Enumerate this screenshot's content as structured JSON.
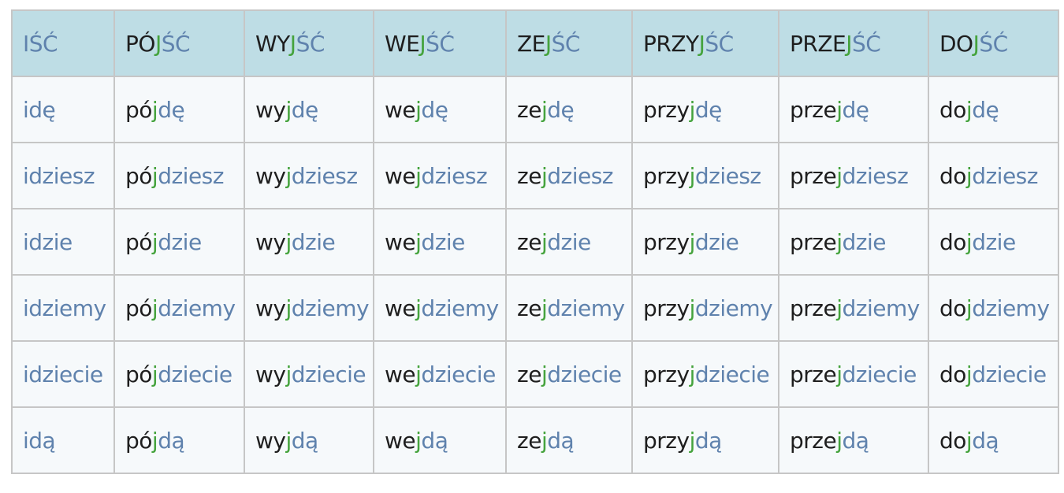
{
  "colors": {
    "header_background": "#bedde5",
    "cell_background": "#f6f9fb",
    "border": "#c6c6c6",
    "prefix_text": "#1e1e1e",
    "stem_text": "#5f82ad",
    "inserted_j": "#45a33d"
  },
  "columns": [
    {
      "header": [
        {
          "t": "IŚĆ",
          "c": "blue"
        }
      ],
      "forms": [
        [
          {
            "t": "i",
            "c": "blue"
          },
          {
            "t": "dę",
            "c": "blue"
          }
        ],
        [
          {
            "t": "i",
            "c": "blue"
          },
          {
            "t": "dziesz",
            "c": "blue"
          }
        ],
        [
          {
            "t": "i",
            "c": "blue"
          },
          {
            "t": "dzie",
            "c": "blue"
          }
        ],
        [
          {
            "t": "i",
            "c": "blue"
          },
          {
            "t": "dziemy",
            "c": "blue"
          }
        ],
        [
          {
            "t": "i",
            "c": "blue"
          },
          {
            "t": "dziecie",
            "c": "blue"
          }
        ],
        [
          {
            "t": "i",
            "c": "blue"
          },
          {
            "t": "dą",
            "c": "blue"
          }
        ]
      ]
    },
    {
      "header": [
        {
          "t": "PÓ",
          "c": "black"
        },
        {
          "t": "J",
          "c": "green"
        },
        {
          "t": "ŚĆ",
          "c": "blue"
        }
      ],
      "forms": [
        [
          {
            "t": "pó",
            "c": "black"
          },
          {
            "t": "j",
            "c": "green"
          },
          {
            "t": "dę",
            "c": "blue"
          }
        ],
        [
          {
            "t": "pó",
            "c": "black"
          },
          {
            "t": "j",
            "c": "green"
          },
          {
            "t": "dziesz",
            "c": "blue"
          }
        ],
        [
          {
            "t": "pó",
            "c": "black"
          },
          {
            "t": "j",
            "c": "green"
          },
          {
            "t": "dzie",
            "c": "blue"
          }
        ],
        [
          {
            "t": "pó",
            "c": "black"
          },
          {
            "t": "j",
            "c": "green"
          },
          {
            "t": "dziemy",
            "c": "blue"
          }
        ],
        [
          {
            "t": "pó",
            "c": "black"
          },
          {
            "t": "j",
            "c": "green"
          },
          {
            "t": "dziecie",
            "c": "blue"
          }
        ],
        [
          {
            "t": "pó",
            "c": "black"
          },
          {
            "t": "j",
            "c": "green"
          },
          {
            "t": "dą",
            "c": "blue"
          }
        ]
      ]
    },
    {
      "header": [
        {
          "t": "WY",
          "c": "black"
        },
        {
          "t": "J",
          "c": "green"
        },
        {
          "t": "ŚĆ",
          "c": "blue"
        }
      ],
      "forms": [
        [
          {
            "t": "wy",
            "c": "black"
          },
          {
            "t": "j",
            "c": "green"
          },
          {
            "t": "dę",
            "c": "blue"
          }
        ],
        [
          {
            "t": "wy",
            "c": "black"
          },
          {
            "t": "j",
            "c": "green"
          },
          {
            "t": "dziesz",
            "c": "blue"
          }
        ],
        [
          {
            "t": "wy",
            "c": "black"
          },
          {
            "t": "j",
            "c": "green"
          },
          {
            "t": "dzie",
            "c": "blue"
          }
        ],
        [
          {
            "t": "wy",
            "c": "black"
          },
          {
            "t": "j",
            "c": "green"
          },
          {
            "t": "dziemy",
            "c": "blue"
          }
        ],
        [
          {
            "t": "wy",
            "c": "black"
          },
          {
            "t": "j",
            "c": "green"
          },
          {
            "t": "dziecie",
            "c": "blue"
          }
        ],
        [
          {
            "t": "wy",
            "c": "black"
          },
          {
            "t": "j",
            "c": "green"
          },
          {
            "t": "dą",
            "c": "blue"
          }
        ]
      ]
    },
    {
      "header": [
        {
          "t": "WE",
          "c": "black"
        },
        {
          "t": "J",
          "c": "green"
        },
        {
          "t": "ŚĆ",
          "c": "blue"
        }
      ],
      "forms": [
        [
          {
            "t": "we",
            "c": "black"
          },
          {
            "t": "j",
            "c": "green"
          },
          {
            "t": "dę",
            "c": "blue"
          }
        ],
        [
          {
            "t": "we",
            "c": "black"
          },
          {
            "t": "j",
            "c": "green"
          },
          {
            "t": "dziesz",
            "c": "blue"
          }
        ],
        [
          {
            "t": "we",
            "c": "black"
          },
          {
            "t": "j",
            "c": "green"
          },
          {
            "t": "dzie",
            "c": "blue"
          }
        ],
        [
          {
            "t": "we",
            "c": "black"
          },
          {
            "t": "j",
            "c": "green"
          },
          {
            "t": "dziemy",
            "c": "blue"
          }
        ],
        [
          {
            "t": "we",
            "c": "black"
          },
          {
            "t": "j",
            "c": "green"
          },
          {
            "t": "dziecie",
            "c": "blue"
          }
        ],
        [
          {
            "t": "we",
            "c": "black"
          },
          {
            "t": "j",
            "c": "green"
          },
          {
            "t": "dą",
            "c": "blue"
          }
        ]
      ]
    },
    {
      "header": [
        {
          "t": "ZE",
          "c": "black"
        },
        {
          "t": "J",
          "c": "green"
        },
        {
          "t": "ŚĆ",
          "c": "blue"
        }
      ],
      "forms": [
        [
          {
            "t": "ze",
            "c": "black"
          },
          {
            "t": "j",
            "c": "green"
          },
          {
            "t": "dę",
            "c": "blue"
          }
        ],
        [
          {
            "t": "ze",
            "c": "black"
          },
          {
            "t": "j",
            "c": "green"
          },
          {
            "t": "dziesz",
            "c": "blue"
          }
        ],
        [
          {
            "t": "ze",
            "c": "black"
          },
          {
            "t": "j",
            "c": "green"
          },
          {
            "t": "dzie",
            "c": "blue"
          }
        ],
        [
          {
            "t": "ze",
            "c": "black"
          },
          {
            "t": "j",
            "c": "green"
          },
          {
            "t": "dziemy",
            "c": "blue"
          }
        ],
        [
          {
            "t": "ze",
            "c": "black"
          },
          {
            "t": "j",
            "c": "green"
          },
          {
            "t": "dziecie",
            "c": "blue"
          }
        ],
        [
          {
            "t": "ze",
            "c": "black"
          },
          {
            "t": "j",
            "c": "green"
          },
          {
            "t": "dą",
            "c": "blue"
          }
        ]
      ]
    },
    {
      "header": [
        {
          "t": "PRZY",
          "c": "black"
        },
        {
          "t": "J",
          "c": "green"
        },
        {
          "t": "ŚĆ",
          "c": "blue"
        }
      ],
      "forms": [
        [
          {
            "t": "przy",
            "c": "black"
          },
          {
            "t": "j",
            "c": "green"
          },
          {
            "t": "dę",
            "c": "blue"
          }
        ],
        [
          {
            "t": "przy",
            "c": "black"
          },
          {
            "t": "j",
            "c": "green"
          },
          {
            "t": "dziesz",
            "c": "blue"
          }
        ],
        [
          {
            "t": "przy",
            "c": "black"
          },
          {
            "t": "j",
            "c": "green"
          },
          {
            "t": "dzie",
            "c": "blue"
          }
        ],
        [
          {
            "t": "przy",
            "c": "black"
          },
          {
            "t": "j",
            "c": "green"
          },
          {
            "t": "dziemy",
            "c": "blue"
          }
        ],
        [
          {
            "t": "przy",
            "c": "black"
          },
          {
            "t": "j",
            "c": "green"
          },
          {
            "t": "dziecie",
            "c": "blue"
          }
        ],
        [
          {
            "t": "przy",
            "c": "black"
          },
          {
            "t": "j",
            "c": "green"
          },
          {
            "t": "dą",
            "c": "blue"
          }
        ]
      ]
    },
    {
      "header": [
        {
          "t": "PRZE",
          "c": "black"
        },
        {
          "t": "J",
          "c": "green"
        },
        {
          "t": "ŚĆ",
          "c": "blue"
        }
      ],
      "forms": [
        [
          {
            "t": "prze",
            "c": "black"
          },
          {
            "t": "j",
            "c": "green"
          },
          {
            "t": "dę",
            "c": "blue"
          }
        ],
        [
          {
            "t": "prze",
            "c": "black"
          },
          {
            "t": "j",
            "c": "green"
          },
          {
            "t": "dziesz",
            "c": "blue"
          }
        ],
        [
          {
            "t": "prze",
            "c": "black"
          },
          {
            "t": "j",
            "c": "green"
          },
          {
            "t": "dzie",
            "c": "blue"
          }
        ],
        [
          {
            "t": "prze",
            "c": "black"
          },
          {
            "t": "j",
            "c": "green"
          },
          {
            "t": "dziemy",
            "c": "blue"
          }
        ],
        [
          {
            "t": "prze",
            "c": "black"
          },
          {
            "t": "j",
            "c": "green"
          },
          {
            "t": "dziecie",
            "c": "blue"
          }
        ],
        [
          {
            "t": "prze",
            "c": "black"
          },
          {
            "t": "j",
            "c": "green"
          },
          {
            "t": "dą",
            "c": "blue"
          }
        ]
      ]
    },
    {
      "header": [
        {
          "t": "DO",
          "c": "black"
        },
        {
          "t": "J",
          "c": "green"
        },
        {
          "t": "ŚĆ",
          "c": "blue"
        }
      ],
      "forms": [
        [
          {
            "t": "do",
            "c": "black"
          },
          {
            "t": "j",
            "c": "green"
          },
          {
            "t": "dę",
            "c": "blue"
          }
        ],
        [
          {
            "t": "do",
            "c": "black"
          },
          {
            "t": "j",
            "c": "green"
          },
          {
            "t": "dziesz",
            "c": "blue"
          }
        ],
        [
          {
            "t": "do",
            "c": "black"
          },
          {
            "t": "j",
            "c": "green"
          },
          {
            "t": "dzie",
            "c": "blue"
          }
        ],
        [
          {
            "t": "do",
            "c": "black"
          },
          {
            "t": "j",
            "c": "green"
          },
          {
            "t": "dziemy",
            "c": "blue"
          }
        ],
        [
          {
            "t": "do",
            "c": "black"
          },
          {
            "t": "j",
            "c": "green"
          },
          {
            "t": "dziecie",
            "c": "blue"
          }
        ],
        [
          {
            "t": "do",
            "c": "black"
          },
          {
            "t": "j",
            "c": "green"
          },
          {
            "t": "dą",
            "c": "blue"
          }
        ]
      ]
    }
  ]
}
